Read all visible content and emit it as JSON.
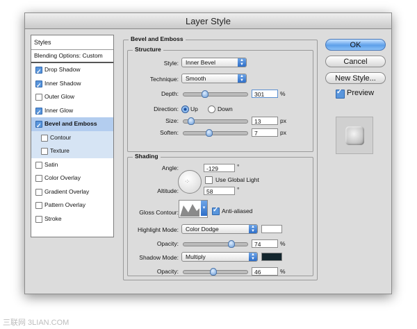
{
  "window": {
    "title": "Layer Style"
  },
  "styles": {
    "header": "Styles",
    "blending": "Blending Options: Custom",
    "items": [
      {
        "label": "Drop Shadow",
        "checked": true
      },
      {
        "label": "Inner Shadow",
        "checked": true
      },
      {
        "label": "Outer Glow",
        "checked": false
      },
      {
        "label": "Inner Glow",
        "checked": true
      },
      {
        "label": "Bevel and Emboss",
        "checked": true,
        "selected": true
      },
      {
        "label": "Contour",
        "checked": false,
        "sub": true
      },
      {
        "label": "Texture",
        "checked": false,
        "sub": true
      },
      {
        "label": "Satin",
        "checked": false
      },
      {
        "label": "Color Overlay",
        "checked": false
      },
      {
        "label": "Gradient Overlay",
        "checked": false
      },
      {
        "label": "Pattern Overlay",
        "checked": false
      },
      {
        "label": "Stroke",
        "checked": false
      }
    ]
  },
  "bevel": {
    "title": "Bevel and Emboss",
    "structure": {
      "title": "Structure",
      "style_label": "Style:",
      "style_value": "Inner Bevel",
      "technique_label": "Technique:",
      "technique_value": "Smooth",
      "depth_label": "Depth:",
      "depth_value": "301",
      "depth_unit": "%",
      "direction_label": "Direction:",
      "dir_up": "Up",
      "dir_down": "Down",
      "direction_selected": "Up",
      "size_label": "Size:",
      "size_value": "13",
      "size_unit": "px",
      "soften_label": "Soften:",
      "soften_value": "7",
      "soften_unit": "px"
    },
    "shading": {
      "title": "Shading",
      "angle_label": "Angle:",
      "angle_value": "-129",
      "angle_unit": "°",
      "global_light_label": "Use Global Light",
      "global_light": false,
      "altitude_label": "Altitude:",
      "altitude_value": "58",
      "altitude_unit": "°",
      "gloss_label": "Gloss Contour:",
      "anti_aliased_label": "Anti-aliased",
      "anti_aliased": true,
      "highlight_label": "Highlight Mode:",
      "highlight_value": "Color Dodge",
      "highlight_color": "#ffffff",
      "h_opacity_label": "Opacity:",
      "h_opacity_value": "74",
      "h_opacity_unit": "%",
      "shadow_label": "Shadow Mode:",
      "shadow_value": "Multiply",
      "shadow_color": "#13262e",
      "s_opacity_label": "Opacity:",
      "s_opacity_value": "46",
      "s_opacity_unit": "%"
    }
  },
  "buttons": {
    "ok": "OK",
    "cancel": "Cancel",
    "new_style": "New Style...",
    "preview": "Preview",
    "preview_checked": true
  },
  "watermark": "三联网 3LIAN.COM"
}
